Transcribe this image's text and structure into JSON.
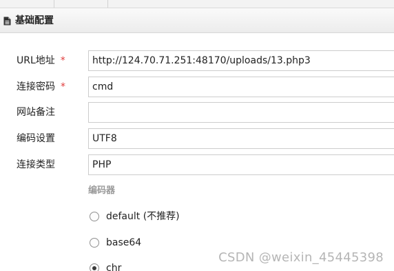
{
  "panel": {
    "title": "基础配置",
    "icon": "document-icon"
  },
  "form": {
    "fields": [
      {
        "label": "URL地址",
        "required": true,
        "value": "http://124.70.71.251:48170/uploads/13.php3"
      },
      {
        "label": "连接密码",
        "required": true,
        "value": "cmd"
      },
      {
        "label": "网站备注",
        "required": false,
        "value": ""
      },
      {
        "label": "编码设置",
        "required": false,
        "value": "UTF8"
      },
      {
        "label": "连接类型",
        "required": false,
        "value": "PHP"
      }
    ],
    "required_mark": "*",
    "encoder": {
      "label": "编码器",
      "options": [
        {
          "label": "default (不推荐)",
          "checked": false
        },
        {
          "label": "base64",
          "checked": false
        },
        {
          "label": "chr",
          "checked": true
        }
      ]
    }
  },
  "watermark": "CSDN @weixin_45445398",
  "colors": {
    "required": "#e03b3b",
    "section_label": "#9a9a9a",
    "border": "#cccccc"
  }
}
